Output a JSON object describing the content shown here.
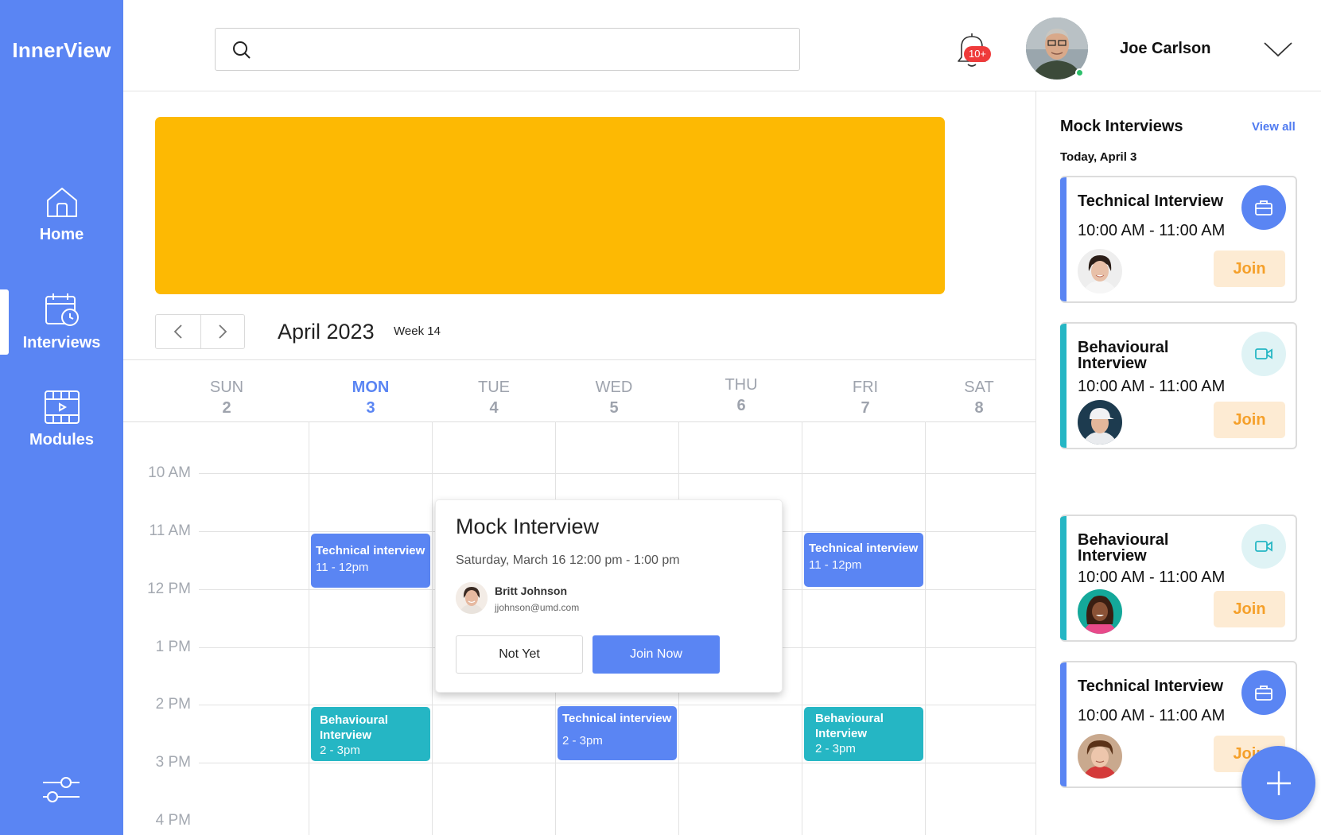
{
  "app": {
    "name": "InnerView"
  },
  "sidebar": {
    "items": [
      {
        "label": "Home",
        "icon": "home-icon"
      },
      {
        "label": "Interviews",
        "icon": "calendar-clock-icon",
        "active": true
      },
      {
        "label": "Modules",
        "icon": "film-icon"
      }
    ],
    "settings_icon": "sliders-icon"
  },
  "header": {
    "search": {
      "placeholder": "",
      "value": ""
    },
    "notifications": {
      "badge": "10+",
      "icon": "bell-icon"
    },
    "user": {
      "name": "Joe Carlson",
      "status": "online"
    }
  },
  "banner": {
    "color": "#fdb903"
  },
  "calendar": {
    "month_label": "April 2023",
    "week_label": "Week 14",
    "days": [
      {
        "name": "SUN",
        "num": "2"
      },
      {
        "name": "MON",
        "num": "3",
        "today": true
      },
      {
        "name": "TUE",
        "num": "4"
      },
      {
        "name": "WED",
        "num": "5"
      },
      {
        "name": "THU",
        "num": "6"
      },
      {
        "name": "FRI",
        "num": "7"
      },
      {
        "name": "SAT",
        "num": "8"
      }
    ],
    "times": [
      "10 AM",
      "11 AM",
      "12 PM",
      "1 PM",
      "2 PM",
      "3 PM",
      "4 PM"
    ],
    "events": [
      {
        "title": "Technical interview",
        "time": "11 - 12pm",
        "day": "MON",
        "type": "tech"
      },
      {
        "title": "Technical interview",
        "time": "11 - 12pm",
        "day": "FRI",
        "type": "tech"
      },
      {
        "title": "Behavioural Interview",
        "time": "2 - 3pm",
        "day": "MON",
        "type": "beh"
      },
      {
        "title": "Technical interview",
        "time": "2 - 3pm",
        "day": "WED",
        "type": "tech"
      },
      {
        "title": "Behavioural Interview",
        "time": "2 - 3pm",
        "day": "FRI",
        "type": "beh"
      }
    ]
  },
  "popup": {
    "title": "Mock Interview",
    "datetime": "Saturday, March 16 12:00 pm - 1:00 pm",
    "person_name": "Britt Johnson",
    "person_email": "jjohnson@umd.com",
    "not_yet_label": "Not Yet",
    "join_now_label": "Join Now"
  },
  "right_panel": {
    "title": "Mock Interviews",
    "view_all": "View all",
    "date": "Today, April 3",
    "cards": [
      {
        "title": "Technical Interview",
        "time": "10:00 AM - 11:00 AM",
        "join": "Join",
        "type": "tech",
        "icon": "briefcase-icon"
      },
      {
        "title": "Behavioural Interview",
        "time": "10:00 AM - 11:00 AM",
        "join": "Join",
        "type": "beh",
        "icon": "video-camera-icon"
      },
      {
        "title": "Behavioural Interview",
        "time": "10:00 AM - 11:00 AM",
        "join": "Join",
        "type": "beh",
        "icon": "video-camera-icon"
      },
      {
        "title": "Technical Interview",
        "time": "10:00 AM - 11:00 AM",
        "join": "Join",
        "type": "tech",
        "icon": "briefcase-icon"
      }
    ]
  },
  "fab": {
    "icon": "plus-icon"
  },
  "colors": {
    "primary": "#5a85f3",
    "teal": "#25b6c4",
    "join_text": "#f5a02a",
    "join_bg": "#fdebd3",
    "badge": "#ef3b3b"
  }
}
